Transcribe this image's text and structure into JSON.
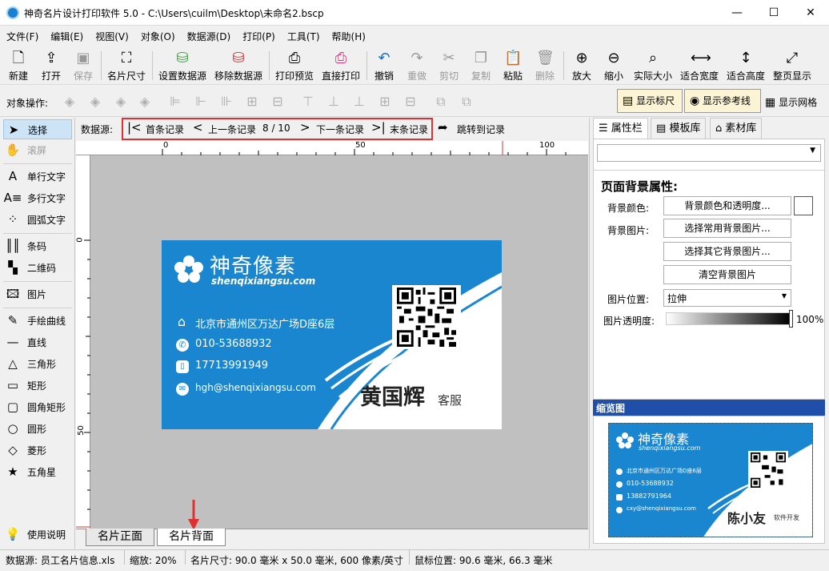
{
  "window": {
    "title": "神奇名片设计打印软件 5.0 - C:\\Users\\cuilm\\Desktop\\未命名2.bscp",
    "minimize": "—",
    "maximize": "☐",
    "close": "✕"
  },
  "menu": [
    "文件(F)",
    "编辑(E)",
    "视图(V)",
    "对象(O)",
    "数据源(D)",
    "打印(P)",
    "工具(T)",
    "帮助(H)"
  ],
  "toolbar": {
    "new": "新建",
    "open": "打开",
    "save": "保存",
    "card_size": "名片尺寸",
    "set_datasource": "设置数据源",
    "remove_datasource": "移除数据源",
    "print_preview": "打印预览",
    "direct_print": "直接打印",
    "undo": "撤销",
    "redo": "重做",
    "cut": "剪切",
    "copy": "复制",
    "paste": "粘贴",
    "delete": "删除",
    "zoom_in": "放大",
    "zoom_out": "缩小",
    "actual_size": "实际大小",
    "fit_width": "适合宽度",
    "fit_height": "适合高度",
    "full_page": "整页显示"
  },
  "object_bar": {
    "label": "对象操作:",
    "show_ruler": "显示标尺",
    "show_guides": "显示参考线",
    "show_grid": "显示网格"
  },
  "tools": {
    "select": "选择",
    "scroll": "滚屏",
    "single_text": "单行文字",
    "multi_text": "多行文字",
    "arc_text": "圆弧文字",
    "barcode": "条码",
    "qrcode": "二维码",
    "image": "图片",
    "freehand": "手绘曲线",
    "line": "直线",
    "triangle": "三角形",
    "rect": "矩形",
    "round_rect": "圆角矩形",
    "circle": "圆形",
    "diamond": "菱形",
    "star": "五角星",
    "help": "使用说明"
  },
  "datasource": {
    "label": "数据源:",
    "first": "首条记录",
    "prev": "上一条记录",
    "position": "8 / 10",
    "next": "下一条记录",
    "last": "末条记录",
    "jump": "跳转到记录"
  },
  "ruler": {
    "h": [
      "0",
      "50",
      "100"
    ],
    "v": [
      "0",
      "50"
    ]
  },
  "card": {
    "brand": "神奇像素",
    "site": "shenqixiangsu.com",
    "address": "北京市通州区万达广场D座6层",
    "phone": "010-53688932",
    "mobile": "17713991949",
    "email": "hgh@shenqixiangsu.com",
    "name": "黄国辉",
    "role": "客服"
  },
  "page_tabs": {
    "front": "名片正面",
    "back": "名片背面"
  },
  "right_tabs": {
    "props": "属性栏",
    "templates": "模板库",
    "materials": "素材库"
  },
  "props": {
    "section_title": "页面背景属性:",
    "bg_color_label": "背景颜色:",
    "bg_color_btn": "背景颜色和透明度...",
    "bg_image_label": "背景图片:",
    "choose_common_bg": "选择常用背景图片...",
    "choose_other_bg": "选择其它背景图片...",
    "clear_bg": "清空背景图片",
    "img_pos_label": "图片位置:",
    "img_pos_value": "拉伸",
    "img_opacity_label": "图片透明度:",
    "img_opacity_value": "100%"
  },
  "preview": {
    "title": "缩览图",
    "brand": "神奇像素",
    "site": "shenqixiangsu.com",
    "address": "北京市通州区万达广场D座6层",
    "phone": "010-53688932",
    "mobile": "13882791964",
    "email": "cxy@shenqixiangsu.com",
    "name": "陈小友",
    "role": "软件开发"
  },
  "status": {
    "datasource": "数据源: 员工名片信息.xls",
    "zoom": "缩放: 20%",
    "card_size": "名片尺寸: 90.0 毫米 x 50.0 毫米, 600 像素/英寸",
    "mouse_pos": "鼠标位置: 90.6 毫米, 66.3 毫米"
  },
  "colors": {
    "card_blue": "#1a86d0",
    "highlight_red": "#e03030",
    "select_blue": "#cde4f7"
  }
}
